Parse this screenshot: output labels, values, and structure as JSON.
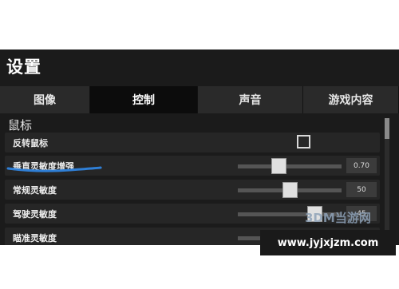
{
  "settings": {
    "title": "设置",
    "tabs": [
      {
        "label": "图像",
        "active": false
      },
      {
        "label": "控制",
        "active": true
      },
      {
        "label": "声音",
        "active": false
      },
      {
        "label": "游戏内容",
        "active": false
      }
    ],
    "section_title": "鼠标",
    "rows": [
      {
        "label": "反转鼠标",
        "type": "checkbox",
        "checked": false
      },
      {
        "label": "垂直灵敏度增强",
        "type": "slider",
        "value_text": "0.70",
        "level": 0.38
      },
      {
        "label": "常规灵敏度",
        "type": "slider",
        "value_text": "50",
        "level": 0.5
      },
      {
        "label": "驾驶灵敏度",
        "type": "slider",
        "value_text": "45",
        "level": 0.78
      },
      {
        "label": "瞄准灵敏度",
        "type": "slider",
        "value_text": "",
        "level": 0.48
      }
    ]
  },
  "watermark": {
    "logo_text": "3DM当游网",
    "url_text": "www.jyjxjzm.com"
  },
  "colors": {
    "background": "#1b1b1b",
    "tab_active": "#0c0c0c",
    "tab_inactive": "#2a2a2a",
    "highlight_underline": "#2f7fd6"
  }
}
